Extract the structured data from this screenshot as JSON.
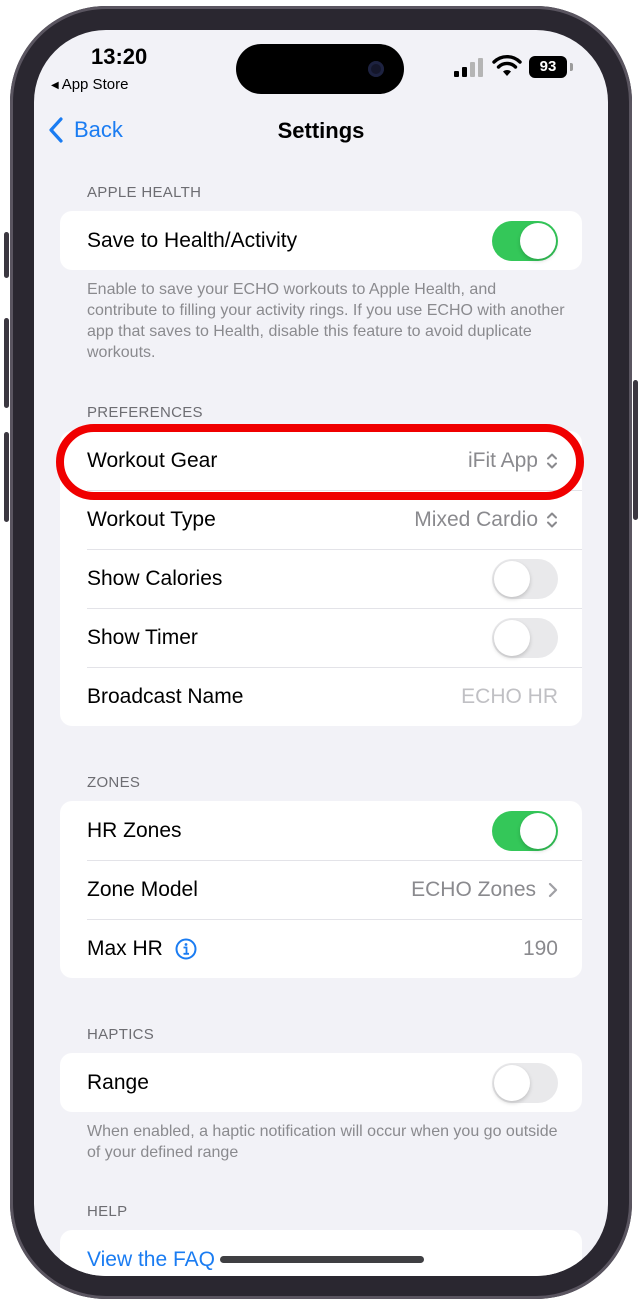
{
  "status": {
    "time": "13:20",
    "back_app": "App Store",
    "battery": "93"
  },
  "nav": {
    "back_label": "Back",
    "title": "Settings"
  },
  "apple_health": {
    "header": "APPLE HEALTH",
    "save_label": "Save to Health/Activity",
    "save_on": true,
    "footer": "Enable to save your ECHO workouts to Apple Health, and contribute to filling your activity rings. If you use ECHO with another app that saves to Health, disable this feature to avoid duplicate workouts."
  },
  "preferences": {
    "header": "PREFERENCES",
    "workout_gear_label": "Workout Gear",
    "workout_gear_value": "iFit App",
    "workout_type_label": "Workout Type",
    "workout_type_value": "Mixed Cardio",
    "show_calories_label": "Show Calories",
    "show_calories_on": false,
    "show_timer_label": "Show Timer",
    "show_timer_on": false,
    "broadcast_label": "Broadcast Name",
    "broadcast_placeholder": "ECHO HR"
  },
  "zones": {
    "header": "ZONES",
    "hr_zones_label": "HR Zones",
    "hr_zones_on": true,
    "zone_model_label": "Zone Model",
    "zone_model_value": "ECHO Zones",
    "max_hr_label": "Max HR",
    "max_hr_value": "190"
  },
  "haptics": {
    "header": "HAPTICS",
    "range_label": "Range",
    "range_on": false,
    "footer": "When enabled, a haptic notification will occur when you go outside of your defined range"
  },
  "help": {
    "header": "HELP",
    "faq_label": "View the FAQ"
  },
  "colors": {
    "accent": "#1a7cf2",
    "toggle_on": "#34c759",
    "highlight": "#f00000"
  }
}
